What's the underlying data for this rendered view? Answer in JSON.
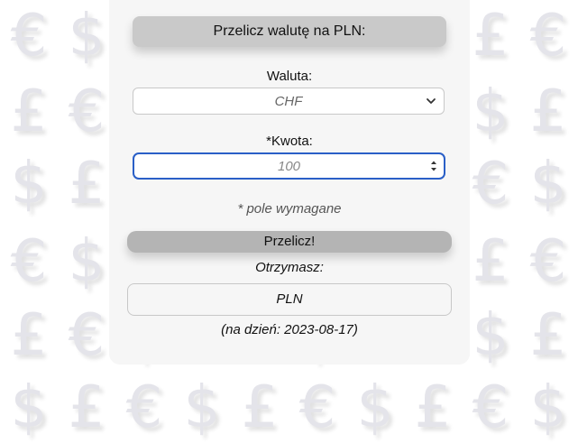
{
  "background": {
    "symbols": [
      "€",
      "$",
      "£"
    ],
    "symbol_color": "#e4e4ea"
  },
  "form": {
    "title": "Przelicz walutę na PLN:",
    "currency_label": "Waluta:",
    "currency_selected": "CHF",
    "amount_label": "*Kwota:",
    "amount_placeholder": "100",
    "required_note": "* pole wymagane",
    "submit_label": "Przelicz!",
    "receive_label": "Otrzymasz:",
    "result_value": "PLN",
    "date_text": "(na dzień: 2023-08-17)",
    "accent_color": "#2a5fc7"
  }
}
